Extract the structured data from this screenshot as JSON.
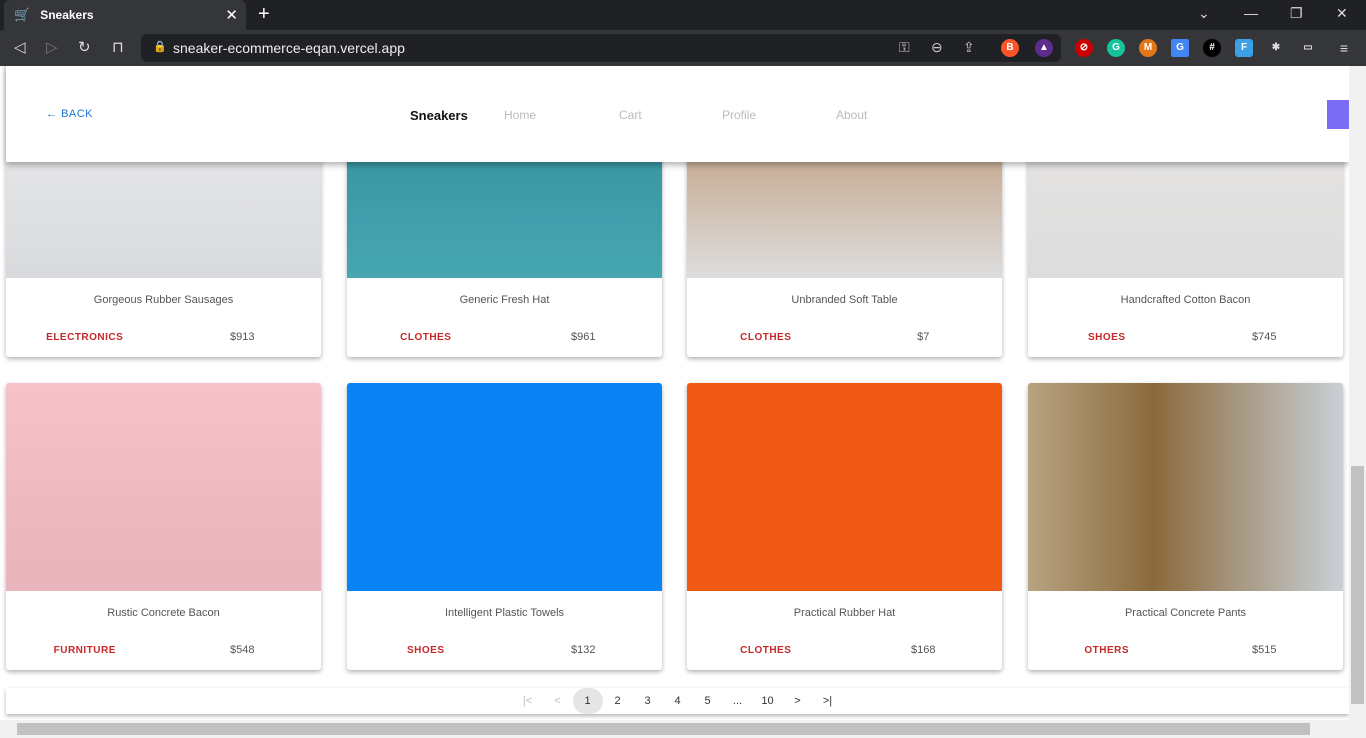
{
  "browser": {
    "tab_title": "Sneakers",
    "url": "sneaker-ecommerce-eqan.vercel.app"
  },
  "header": {
    "back_label": "BACK",
    "brand": "Sneakers",
    "nav": [
      "Home",
      "Cart",
      "Profile",
      "About"
    ]
  },
  "products": [
    {
      "title": "Gorgeous Rubber Sausages",
      "category": "ELECTRONICS",
      "price": "$913",
      "image": "smartwatch"
    },
    {
      "title": "Generic Fresh Hat",
      "category": "CLOTHES",
      "price": "$961",
      "image": "woman-on-bench"
    },
    {
      "title": "Unbranded Soft Table",
      "category": "CLOTHES",
      "price": "$7",
      "image": "beige-top"
    },
    {
      "title": "Handcrafted Cotton Bacon",
      "category": "SHOES",
      "price": "$745",
      "image": "orange-sneaker"
    },
    {
      "title": "Rustic Concrete Bacon",
      "category": "FURNITURE",
      "price": "$548",
      "image": "pink-chair"
    },
    {
      "title": "Intelligent Plastic Towels",
      "category": "SHOES",
      "price": "$132",
      "image": "blue-sneaker"
    },
    {
      "title": "Practical Rubber Hat",
      "category": "CLOTHES",
      "price": "$168",
      "image": "woman-orange-wall"
    },
    {
      "title": "Practical Concrete Pants",
      "category": "OTHERS",
      "price": "$515",
      "image": "pizza"
    }
  ],
  "pagination": {
    "pages": [
      "1",
      "2",
      "3",
      "4",
      "5",
      "...",
      "10"
    ],
    "current": "1"
  },
  "colors": {
    "accent": "#1976d2",
    "category": "#c62828"
  }
}
